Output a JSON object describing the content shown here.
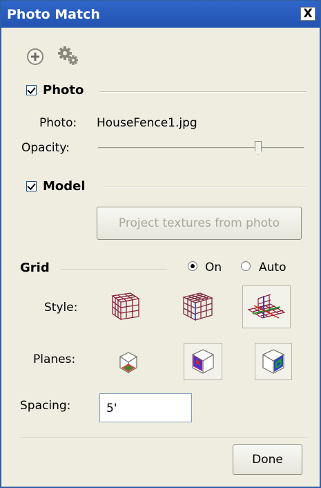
{
  "window": {
    "title": "Photo Match",
    "close_label": "X"
  },
  "toolbar": {
    "icons": [
      "add-icon",
      "settings-gear-icon"
    ]
  },
  "photo_section": {
    "label": "Photo",
    "checked": true,
    "photo_label": "Photo:",
    "photo_value": "HouseFence1.jpg",
    "opacity_label": "Opacity:",
    "opacity_value": 0.77
  },
  "model_section": {
    "label": "Model",
    "checked": true,
    "project_button_label": "Project textures from photo",
    "project_button_enabled": false
  },
  "grid_section": {
    "label": "Grid",
    "mode_options": [
      {
        "label": "On",
        "selected": true
      },
      {
        "label": "Auto",
        "selected": false
      }
    ],
    "style_label": "Style:",
    "styles": [
      "grid-style-inside-icon",
      "grid-style-outside-icon",
      "grid-style-planes-icon"
    ],
    "selected_style": 2,
    "planes_label": "Planes:",
    "planes": [
      "plane-red-green-icon",
      "plane-red-blue-icon",
      "plane-green-blue-icon"
    ],
    "selected_planes": [
      1,
      2
    ],
    "spacing_label": "Spacing:",
    "spacing_value": "5'"
  },
  "footer": {
    "done_label": "Done"
  },
  "colors": {
    "titlebar": "#2353b0",
    "panel": "#eeede0",
    "red_axis": "#d0281e",
    "green_axis": "#1f9a2b",
    "blue_axis": "#2b3fd0"
  }
}
